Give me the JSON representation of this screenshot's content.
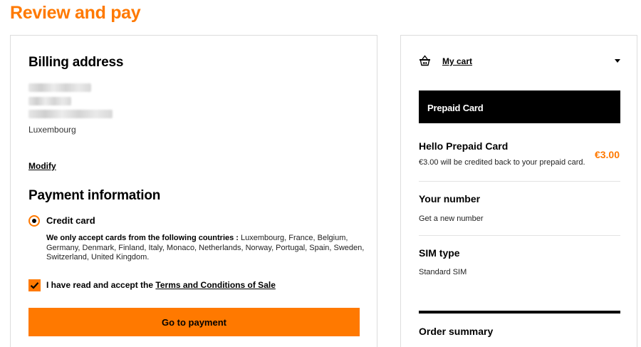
{
  "page": {
    "title": "Review and pay"
  },
  "billing": {
    "heading": "Billing address",
    "country": "Luxembourg",
    "modify_label": "Modify"
  },
  "payment": {
    "heading": "Payment information",
    "method_label": "Credit card",
    "method_selected": true,
    "countries_intro": "We only accept cards from the following countries :",
    "countries_list": " Luxembourg, France, Belgium, Germany, Denmark, Finland, Italy, Monaco, Netherlands, Norway, Portugal, Spain, Sweden, Switzerland, United Kingdom.",
    "accept_prefix": "I have read and accept the ",
    "accept_link": "Terms and Conditions of Sale",
    "accept_checked": true,
    "submit_label": "Go to payment"
  },
  "cart": {
    "header_label": "My cart",
    "product_banner": "Prepaid Card",
    "item": {
      "title": "Hello Prepaid Card",
      "description": "€3.00 will be credited back to your prepaid card.",
      "price": "€3.00"
    },
    "number": {
      "title": "Your number",
      "value": "Get a new number"
    },
    "sim": {
      "title": "SIM type",
      "value": "Standard SIM"
    },
    "summary_title": "Order summary"
  },
  "colors": {
    "accent": "#ff7900",
    "dark": "#000000",
    "border": "#dddddd"
  }
}
